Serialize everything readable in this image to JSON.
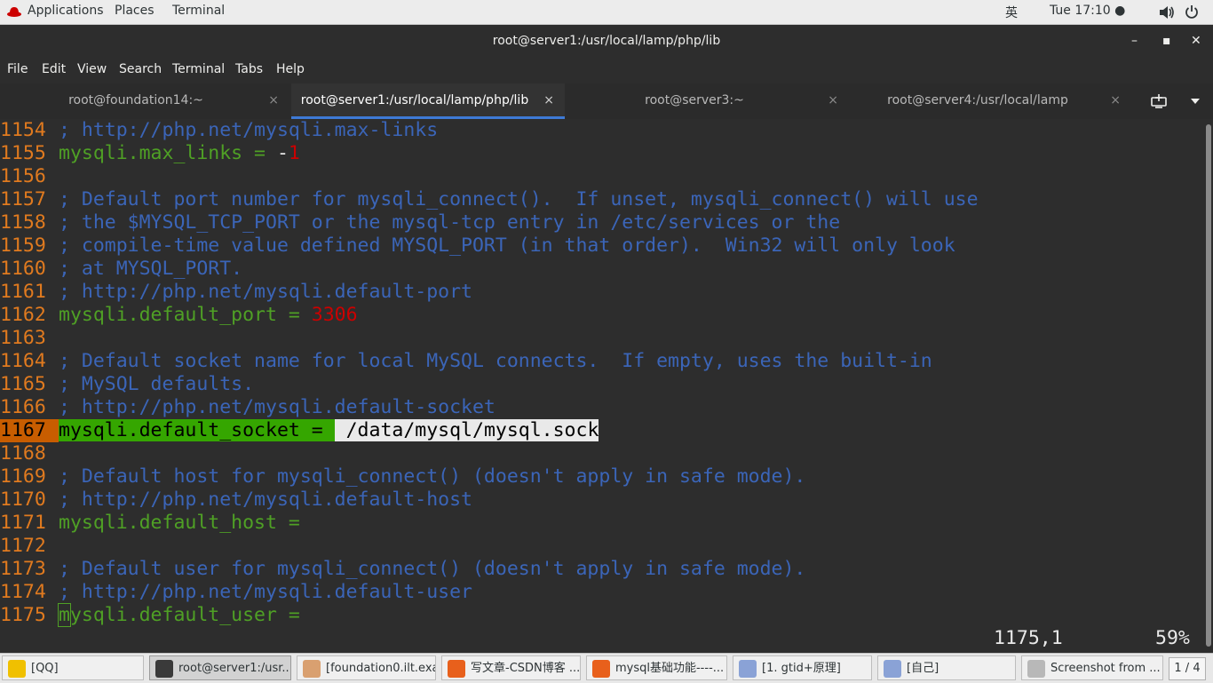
{
  "topbar": {
    "applications": "Applications",
    "places": "Places",
    "terminal": "Terminal",
    "input_method": "英",
    "clock": "Tue 17:10 ●"
  },
  "window": {
    "title": "root@server1:/usr/local/lamp/php/lib",
    "minimize": "–",
    "maximize": "▪",
    "close": "✕"
  },
  "menubar": [
    "File",
    "Edit",
    "View",
    "Search",
    "Terminal",
    "Tabs",
    "Help"
  ],
  "tabs": [
    {
      "label": "root@foundation14:~",
      "active": false
    },
    {
      "label": "root@server1:/usr/local/lamp/php/lib",
      "active": true
    },
    {
      "label": "root@server3:~",
      "active": false
    },
    {
      "label": "root@server4:/usr/local/lamp",
      "active": false
    }
  ],
  "tab_close": "×",
  "terminal_lines": [
    {
      "n": "1154",
      "parts": [
        [
          "cmt",
          "; http://php.net/mysqli.max-links"
        ]
      ]
    },
    {
      "n": "1155",
      "parts": [
        [
          "key",
          "mysqli.max_links = "
        ],
        [
          "val",
          "-"
        ],
        [
          "num",
          "1"
        ]
      ]
    },
    {
      "n": "1156",
      "parts": []
    },
    {
      "n": "1157",
      "parts": [
        [
          "cmt",
          "; Default port number for mysqli_connect().  If unset, mysqli_connect() will use"
        ]
      ]
    },
    {
      "n": "1158",
      "parts": [
        [
          "cmt",
          "; the $MYSQL_TCP_PORT or the mysql-tcp entry in /etc/services or the"
        ]
      ]
    },
    {
      "n": "1159",
      "parts": [
        [
          "cmt",
          "; compile-time value defined MYSQL_PORT (in that order).  Win32 will only look"
        ]
      ]
    },
    {
      "n": "1160",
      "parts": [
        [
          "cmt",
          "; at MYSQL_PORT."
        ]
      ]
    },
    {
      "n": "1161",
      "parts": [
        [
          "cmt",
          "; http://php.net/mysqli.default-port"
        ]
      ]
    },
    {
      "n": "1162",
      "parts": [
        [
          "key",
          "mysqli.default_port = "
        ],
        [
          "num",
          "3306"
        ]
      ]
    },
    {
      "n": "1163",
      "parts": []
    },
    {
      "n": "1164",
      "parts": [
        [
          "cmt",
          "; Default socket name for local MySQL connects.  If empty, uses the built-in"
        ]
      ]
    },
    {
      "n": "1165",
      "parts": [
        [
          "cmt",
          "; MySQL defaults."
        ]
      ]
    },
    {
      "n": "1166",
      "parts": [
        [
          "cmt",
          "; http://php.net/mysqli.default-socket"
        ]
      ]
    },
    {
      "n": "1167",
      "hl": true,
      "parts": [
        [
          "hl-green",
          "mysqli.default_socket = "
        ],
        [
          "hl-white",
          " /data/mysql/mysql.sock"
        ]
      ]
    },
    {
      "n": "1168",
      "parts": []
    },
    {
      "n": "1169",
      "parts": [
        [
          "cmt",
          "; Default host for mysqli_connect() (doesn't apply in safe mode)."
        ]
      ]
    },
    {
      "n": "1170",
      "parts": [
        [
          "cmt",
          "; http://php.net/mysqli.default-host"
        ]
      ]
    },
    {
      "n": "1171",
      "parts": [
        [
          "key",
          "mysqli.default_host ="
        ]
      ]
    },
    {
      "n": "1172",
      "parts": []
    },
    {
      "n": "1173",
      "parts": [
        [
          "cmt",
          "; Default user for mysqli_connect() (doesn't apply in safe mode)."
        ]
      ]
    },
    {
      "n": "1174",
      "parts": [
        [
          "cmt",
          "; http://php.net/mysqli.default-user"
        ]
      ]
    },
    {
      "n": "1175",
      "cursor": true,
      "parts": [
        [
          "key cursor",
          "m"
        ],
        [
          "key",
          "ysqli.default_user ="
        ]
      ]
    }
  ],
  "status": {
    "position": "1175,1",
    "percent": "59%"
  },
  "taskbar": [
    {
      "label": "[QQ]",
      "icon_color": "#f0c000",
      "active": false
    },
    {
      "label": "root@server1:/usr...",
      "icon_color": "#3a3a3a",
      "active": true
    },
    {
      "label": "[foundation0.ilt.exa...",
      "icon_color": "#d9a070",
      "active": false
    },
    {
      "label": "写文章-CSDN博客 ...",
      "icon_color": "#e8601c",
      "active": false
    },
    {
      "label": "mysql基础功能----...",
      "icon_color": "#e8601c",
      "active": false
    },
    {
      "label": "[1. gtid+原理]",
      "icon_color": "#8aa2d6",
      "active": false
    },
    {
      "label": "[自己]",
      "icon_color": "#8aa2d6",
      "active": false
    },
    {
      "label": "Screenshot from ...",
      "icon_color": "#b8b8b8",
      "active": false
    }
  ],
  "pager": "1 / 4"
}
